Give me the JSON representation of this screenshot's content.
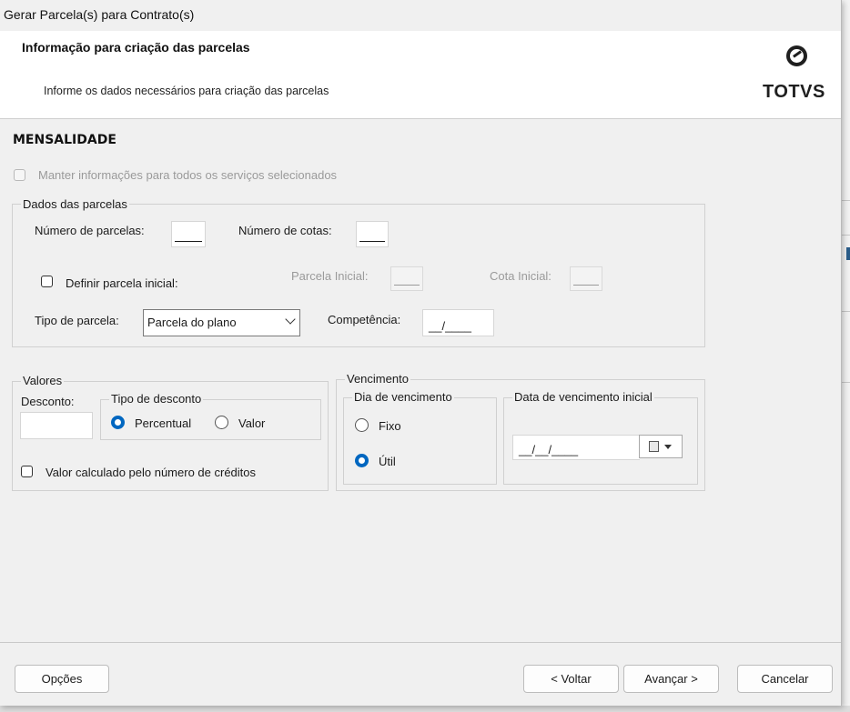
{
  "window": {
    "title": "Gerar Parcela(s) para Contrato(s)"
  },
  "header": {
    "title": "Informação para criação das parcelas",
    "subtitle": "Informe os dados necessários para criação das parcelas",
    "logo_text": "TOTVS"
  },
  "section": {
    "title": "MENSALIDADE"
  },
  "manter": {
    "label": "Manter informações para todos os serviços selecionados",
    "checked": false,
    "enabled": false
  },
  "dados": {
    "title": "Dados das parcelas",
    "numero_parcelas_label": "Número de parcelas:",
    "numero_parcelas_value": "",
    "numero_cotas_label": "Número de cotas:",
    "numero_cotas_value": "",
    "definir_label": "Definir parcela inicial:",
    "parcela_inicial_label": "Parcela Inicial:",
    "cota_inicial_label": "Cota Inicial:",
    "tipo_parcela_label": "Tipo de parcela:",
    "tipo_parcela_value": "Parcela do plano",
    "competencia_label": "Competência:",
    "competencia_mask": "__/____"
  },
  "valores": {
    "title": "Valores",
    "desconto_label": "Desconto:",
    "desconto_value": "",
    "tipo_title": "Tipo de desconto",
    "percentual_label": "Percentual",
    "valor_label": "Valor",
    "selected": "Percentual",
    "calc_label": "Valor calculado pelo número de créditos"
  },
  "vencimento": {
    "title": "Vencimento",
    "dia_title": "Dia de vencimento",
    "fixo_label": "Fixo",
    "util_label": "Útil",
    "selected": "Útil",
    "data_title": "Data de vencimento inicial",
    "data_mask": "__/__/____"
  },
  "footer": {
    "opcoes": "Opções",
    "voltar": "< Voltar",
    "avancar": "Avançar >",
    "cancelar": "Cancelar"
  },
  "colors": {
    "accent": "#0067c0",
    "window_bg": "#f0f0f0"
  },
  "icons": {
    "logo": "totvs-logo-icon",
    "calendar": "calendar-icon",
    "dropdown": "chevron-down-icon"
  }
}
